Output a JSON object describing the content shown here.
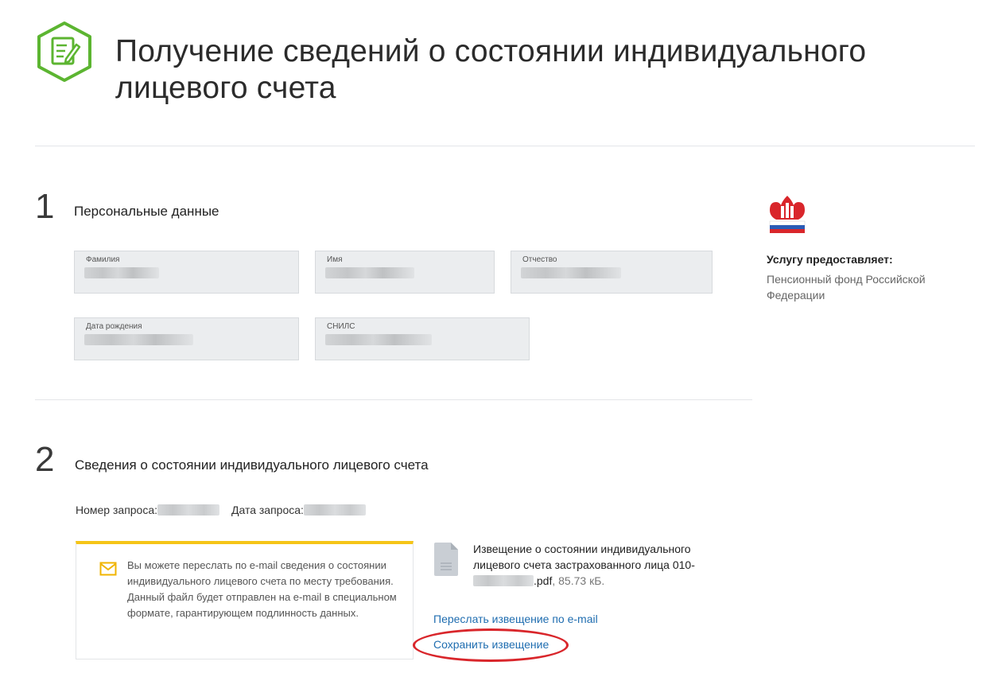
{
  "header": {
    "title": "Получение сведений о состоянии индивидуального лицевого счета",
    "icon": "document-edit-icon",
    "accent_color": "#5cb531"
  },
  "step1": {
    "number": "1",
    "title": "Персональные данные",
    "fields": {
      "surname": {
        "label": "Фамилия",
        "value": "",
        "masked_fraction": 0.35
      },
      "name": {
        "label": "Имя",
        "value": "",
        "masked_fraction": 0.5
      },
      "patronymic": {
        "label": "Отчество",
        "value": "",
        "masked_fraction": 0.5
      },
      "birthdate": {
        "label": "Дата рождения",
        "value": "",
        "masked_fraction": 0.5
      },
      "snils": {
        "label": "СНИЛС",
        "value": "",
        "masked_fraction": 0.5
      }
    }
  },
  "provider": {
    "label": "Услугу предоставляет:",
    "name": "Пенсионный фонд Российской Федерации",
    "logo": "pfr-logo",
    "logo_color": "#d9262b"
  },
  "step2": {
    "number": "2",
    "title": "Сведения о состоянии индивидуального лицевого счета",
    "request_number_label": "Номер запроса:",
    "request_number_value": "",
    "request_date_label": "Дата запроса:",
    "request_date_value": ""
  },
  "notice": {
    "icon": "envelope-icon",
    "text": "Вы можете переслать по e-mail сведения о состоянии индивидуального лицевого счета по месту требования. Данный файл будет отправлен на e-mail в специальном формате, гарантирующем подлинность данных.",
    "accent_color": "#f5c518"
  },
  "file": {
    "icon": "file-icon",
    "name_prefix": "Извещение о состоянии индивидуального лицевого счета застрахованного лица 010-",
    "name_suffix": ".pdf",
    "size": ", 85.73 кБ."
  },
  "actions": {
    "email_link": "Переслать извещение по e-mail",
    "save_link": "Сохранить извещение",
    "highlight_color": "#d9262b"
  }
}
